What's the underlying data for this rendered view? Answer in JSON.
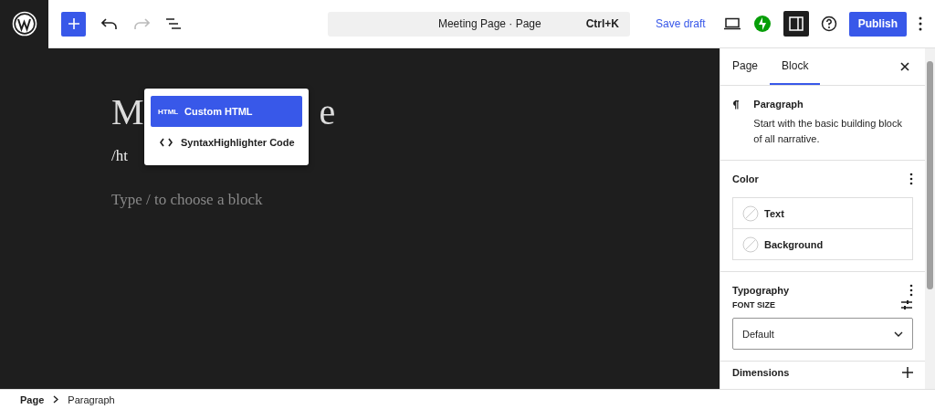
{
  "toolbar": {
    "undo_disabled": false,
    "redo_disabled": true
  },
  "command_bar": {
    "title": "Meeting Page · Page",
    "shortcut": "Ctrl+K"
  },
  "actions": {
    "save_draft": "Save draft",
    "publish": "Publish",
    "settings_selected": true
  },
  "editor": {
    "title_fragments": [
      "M",
      "e"
    ],
    "paragraph": "/ht",
    "placeholder": "Type / to choose a block"
  },
  "block_popup": [
    {
      "kind": "text-icon",
      "icon_text": "HTML",
      "label": "Custom HTML",
      "selected": true
    },
    {
      "kind": "code-icon",
      "label": "SyntaxHighlighter Code",
      "selected": false
    }
  ],
  "sidebar": {
    "tabs": [
      {
        "label": "Page",
        "selected": false
      },
      {
        "label": "Block",
        "selected": true
      }
    ],
    "block_card": {
      "title": "Paragraph",
      "description": "Start with the basic building block of all narrative."
    },
    "color": {
      "title": "Color",
      "items": [
        "Text",
        "Background"
      ]
    },
    "typography": {
      "title": "Typography",
      "font_size_label": "FONT SIZE",
      "font_size_value": "Default"
    },
    "dimensions": {
      "title": "Dimensions"
    }
  },
  "breadcrumb": [
    "Page",
    "Paragraph"
  ]
}
